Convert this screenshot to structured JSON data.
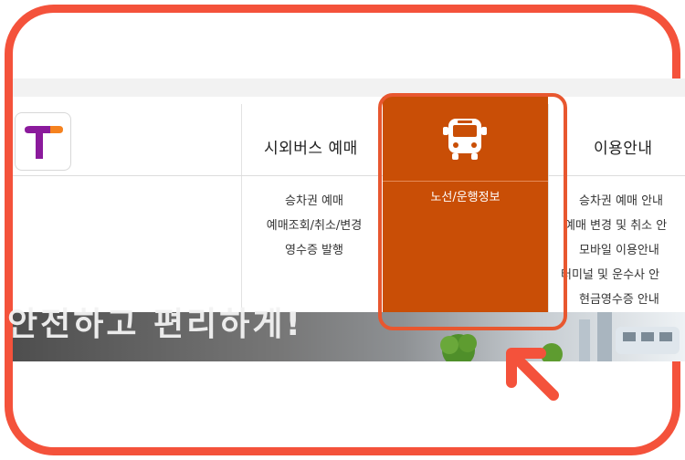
{
  "menu": {
    "items": [
      {
        "label": "시외버스 예매",
        "submenu": [
          "승차권 예매",
          "예매조회/취소/변경",
          "영수증 발행"
        ]
      },
      {
        "label": "",
        "submenu": [
          "노선/운행정보"
        ]
      },
      {
        "label": "이용안내",
        "submenu": [
          "승차권 예매 안내",
          "예매 변경 및 취소 안",
          "모바일 이용안내",
          "터미널 및 운수사 안",
          "현금영수증 안내"
        ]
      }
    ]
  },
  "banner": {
    "text": "안전하고 편리하게!"
  },
  "colors": {
    "accent": "#c94e06",
    "highlight": "#e8572f",
    "logo_purple": "#8b1a9c",
    "logo_orange": "#f5821f"
  },
  "icons": {
    "logo": "t-logo",
    "active_menu": "bus-icon",
    "pointer": "arrow-icon"
  }
}
